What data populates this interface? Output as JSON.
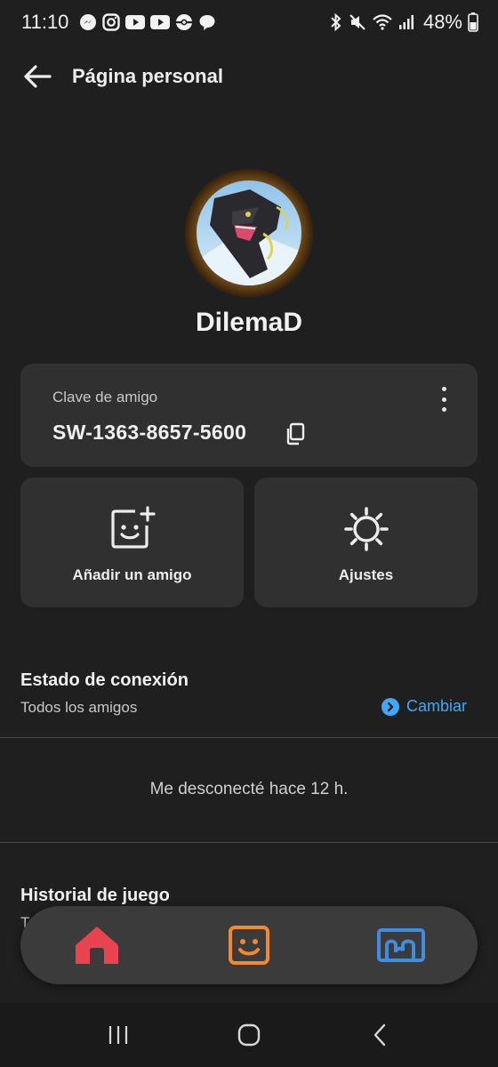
{
  "status_bar": {
    "time": "11:10",
    "battery": "48%",
    "left_icons": [
      "messenger-icon",
      "instagram-icon",
      "youtube-icon",
      "youtube-icon",
      "pokeball-icon",
      "chat-bubble-icon"
    ],
    "right_icons": [
      "bluetooth-icon",
      "mute-icon",
      "wifi-icon",
      "signal-icon",
      "battery-icon"
    ]
  },
  "header": {
    "title": "Página personal"
  },
  "profile": {
    "username": "DilemaD"
  },
  "friend_code": {
    "label": "Clave de amigo",
    "code": "SW-1363-8657-5600"
  },
  "actions": {
    "add_friend": "Añadir un amigo",
    "settings": "Ajustes"
  },
  "online_status": {
    "title": "Estado de conexión",
    "value": "Todos los amigos",
    "change_label": "Cambiar"
  },
  "last_seen": "Me desconecté hace 12 h.",
  "play_history": {
    "title": "Historial de juego",
    "subtitle": "T"
  },
  "colors": {
    "background": "#1f1f1f",
    "card": "#303030",
    "accent_blue": "#3fa9f5",
    "home_red": "#e8434f",
    "friends_orange": "#f08a2c",
    "album_blue": "#3f8de0"
  }
}
